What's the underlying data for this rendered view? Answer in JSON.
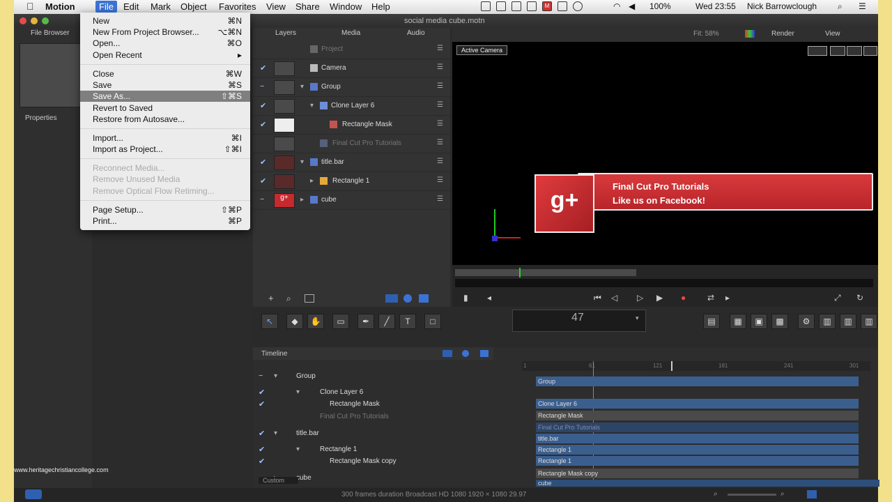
{
  "menubar": {
    "app_name": "Motion",
    "items": [
      "File",
      "Edit",
      "Mark",
      "Object",
      "Favorites",
      "View",
      "Share",
      "Window",
      "Help"
    ],
    "battery": "100%",
    "clock": "Wed 23:55",
    "user": "Nick Barrowclough"
  },
  "window": {
    "title": "social media cube.motn"
  },
  "left_panel": {
    "file_browser": "File Browser",
    "properties": "Properties"
  },
  "file_menu": {
    "items": [
      {
        "label": "New",
        "shortcut": "⌘N"
      },
      {
        "label": "New From Project Browser...",
        "shortcut": "⌥⌘N"
      },
      {
        "label": "Open...",
        "shortcut": "⌘O"
      },
      {
        "label": "Open Recent",
        "shortcut": "▸"
      },
      {
        "label": "Close",
        "shortcut": "⌘W"
      },
      {
        "label": "Save",
        "shortcut": "⌘S"
      },
      {
        "label": "Save As...",
        "shortcut": "⇧⌘S"
      },
      {
        "label": "Revert to Saved",
        "shortcut": ""
      },
      {
        "label": "Restore from Autosave...",
        "shortcut": ""
      },
      {
        "label": "Import...",
        "shortcut": "⌘I"
      },
      {
        "label": "Import as Project...",
        "shortcut": "⇧⌘I"
      },
      {
        "label": "Reconnect Media...",
        "shortcut": ""
      },
      {
        "label": "Remove Unused Media",
        "shortcut": ""
      },
      {
        "label": "Remove Optical Flow Retiming...",
        "shortcut": ""
      },
      {
        "label": "Page Setup...",
        "shortcut": "⇧⌘P"
      },
      {
        "label": "Print...",
        "shortcut": "⌘P"
      }
    ]
  },
  "layers_panel": {
    "tabs": [
      "Layers",
      "Media",
      "Audio"
    ],
    "rows": [
      {
        "name": "Project"
      },
      {
        "name": "Camera"
      },
      {
        "name": "Group"
      },
      {
        "name": "Clone Layer 6"
      },
      {
        "name": "Rectangle Mask"
      },
      {
        "name": "Final Cut Pro Tutorials"
      },
      {
        "name": "title.bar"
      },
      {
        "name": "Rectangle 1"
      },
      {
        "name": "cube"
      }
    ]
  },
  "canvas": {
    "fit": "Fit: 58%",
    "render": "Render",
    "view": "View",
    "camera_select": "Active Camera",
    "banner_line1": "Final Cut Pro Tutorials",
    "banner_line2": "Like us on Facebook!",
    "gplus": "g+"
  },
  "toolbar": {
    "frame_number": "47"
  },
  "timeline": {
    "label": "Timeline",
    "rows": [
      {
        "name": "Group"
      },
      {
        "name": "Clone Layer 6"
      },
      {
        "name": "Rectangle Mask"
      },
      {
        "name": "Final Cut Pro Tutorials"
      },
      {
        "name": "title.bar"
      },
      {
        "name": "Rectangle 1"
      },
      {
        "name": "Rectangle Mask copy"
      },
      {
        "name": "cube"
      }
    ],
    "bars": [
      "Group",
      "Clone Layer 6",
      "Rectangle Mask",
      "Final Cut Pro Tutorials",
      "title.bar",
      "Rectangle 1",
      "Rectangle 1",
      "Rectangle Mask copy",
      "cube"
    ],
    "ruler": [
      "1",
      "61",
      "121",
      "181",
      "241",
      "301"
    ],
    "preset": "Custom"
  },
  "status": {
    "text": "300 frames duration Broadcast HD 1080 1920 × 1080 29.97"
  },
  "watermark": "www.heritagechristiancollege.com",
  "colors": {
    "accent": "#3b73d4",
    "banner_red": "#c62a2e",
    "bar_blue": "#3a5f8f"
  }
}
